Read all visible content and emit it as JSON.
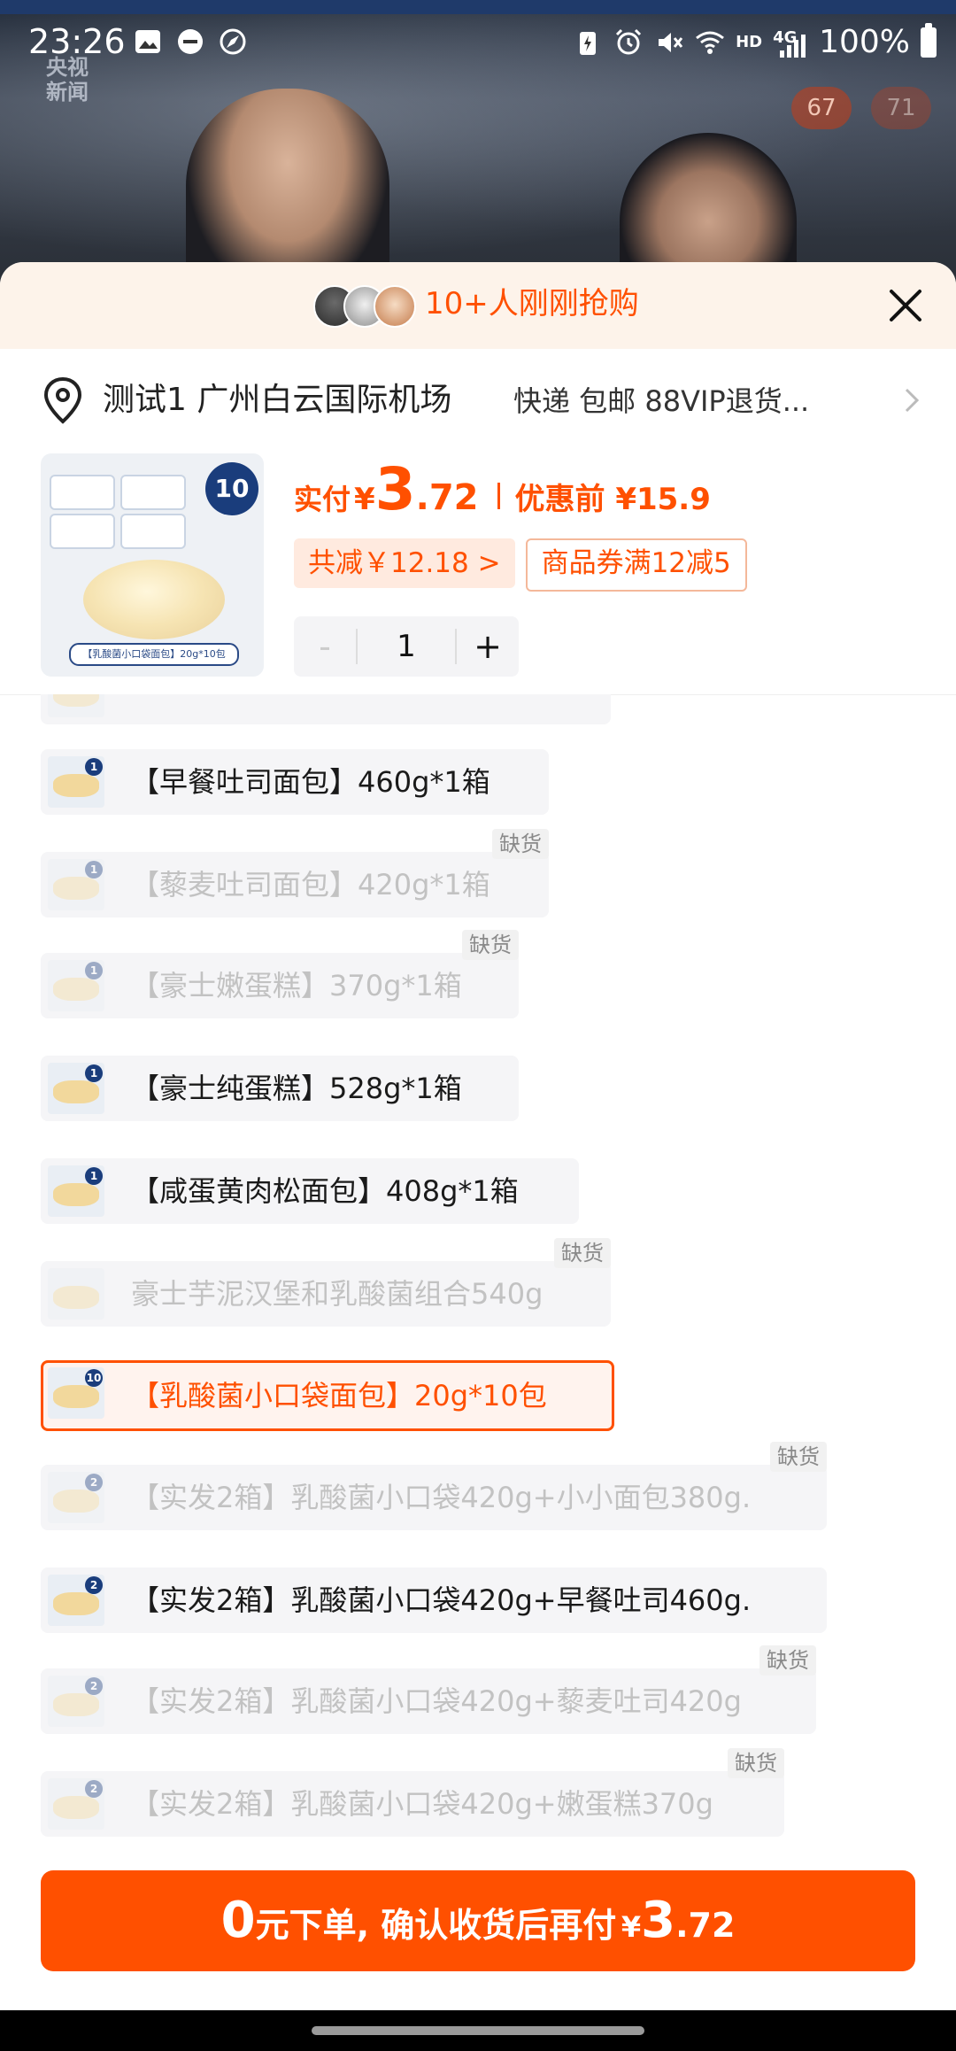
{
  "status_bar": {
    "time": "23:26",
    "network": "4G",
    "hd": "HD",
    "battery": "100%"
  },
  "video": {
    "channel_logo_line1": "央视",
    "channel_logo_line2": "新闻",
    "badge_a": "67",
    "badge_b": "71"
  },
  "header": {
    "buyers_text": "10+人刚刚抢购"
  },
  "address": {
    "text": "测试1 广州白云国际机场",
    "shipping": "快递 包邮 88VIP退货..."
  },
  "product": {
    "thumb_badge": "10",
    "thumb_caption": "【乳酸菌小口袋面包】20g*10包",
    "price_label": "实付",
    "currency": "¥",
    "price_int": "3",
    "price_dec": ".72",
    "price_before": "优惠前 ¥15.9",
    "discount_chip": "共减￥12.18 >",
    "coupon_chip": "商品券满12减5",
    "qty_minus": "-",
    "qty": "1",
    "qty_plus": "+"
  },
  "skus": [
    {
      "label": "【早餐吐司面包】460g*1箱",
      "badge": "1",
      "disabled": false
    },
    {
      "label": "【藜麦吐司面包】420g*1箱",
      "badge": "1",
      "disabled": true,
      "tag": "缺货"
    },
    {
      "label": "【豪士嫩蛋糕】370g*1箱",
      "badge": "1",
      "disabled": true,
      "tag": "缺货"
    },
    {
      "label": "【豪士纯蛋糕】528g*1箱",
      "badge": "1",
      "disabled": false
    },
    {
      "label": "【咸蛋黄肉松面包】408g*1箱",
      "badge": "1",
      "disabled": false
    },
    {
      "label": "豪士芋泥汉堡和乳酸菌组合540g",
      "badge": "",
      "disabled": true,
      "tag": "缺货"
    },
    {
      "label": "【乳酸菌小口袋面包】20g*10包",
      "badge": "10",
      "disabled": false,
      "selected": true
    },
    {
      "label": "【实发2箱】乳酸菌小口袋420g+小小面包380g.",
      "badge": "2",
      "disabled": true,
      "tag": "缺货"
    },
    {
      "label": "【实发2箱】乳酸菌小口袋420g+早餐吐司460g.",
      "badge": "2",
      "disabled": false
    },
    {
      "label": "【实发2箱】乳酸菌小口袋420g+藜麦吐司420g",
      "badge": "2",
      "disabled": true,
      "tag": "缺货"
    },
    {
      "label": "【实发2箱】乳酸菌小口袋420g+嫩蛋糕370g",
      "badge": "2",
      "disabled": true,
      "tag": "缺货"
    }
  ],
  "buy_button": {
    "zero": "0",
    "text": "元下单, 确认收货后再付",
    "yen": "¥",
    "price_int": "3",
    "price_dec": ".72"
  },
  "colors": {
    "accent": "#ff5000",
    "header_bg": "#fdf3ea"
  },
  "icons": [
    "gallery-icon",
    "dnd-icon",
    "compass-icon",
    "battery-saver-icon",
    "alarm-icon",
    "mute-icon",
    "wifi-icon",
    "signal-icon",
    "close-icon",
    "location-pin-icon",
    "chevron-right-icon"
  ]
}
